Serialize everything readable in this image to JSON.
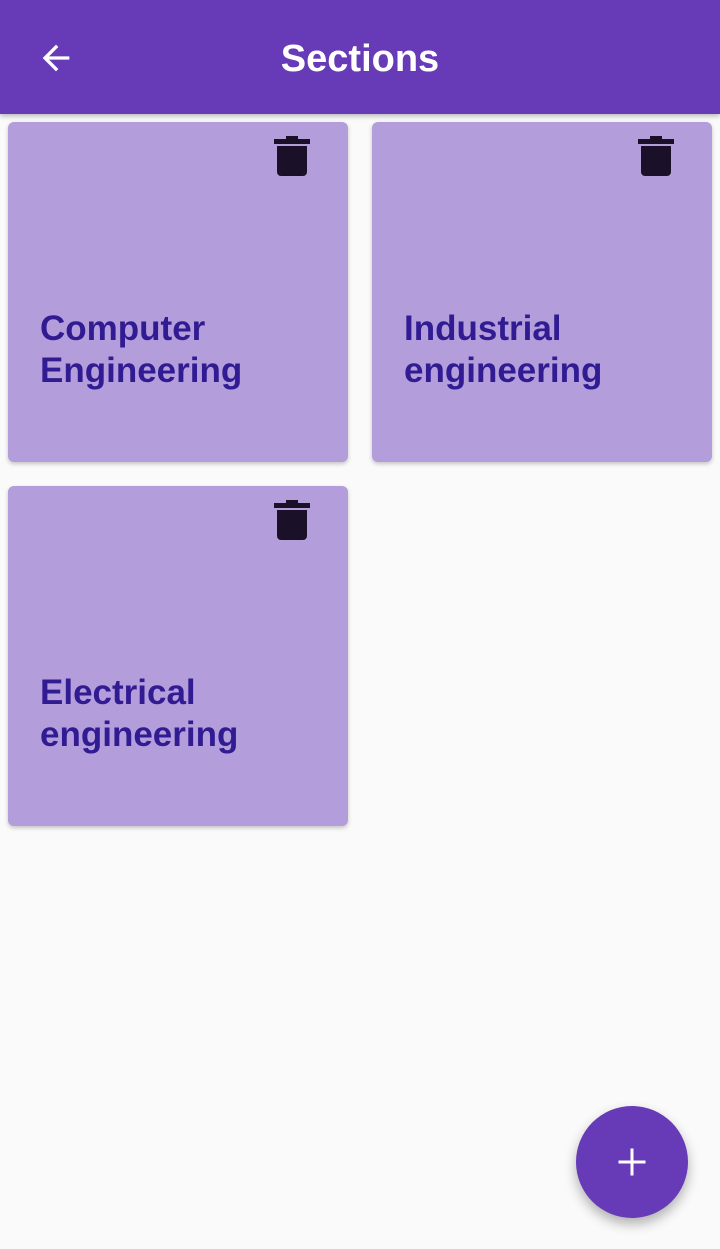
{
  "app_bar": {
    "title": "Sections",
    "back_icon": "arrow-back-icon",
    "color": "#673ab7"
  },
  "sections": [
    {
      "label": "Computer\nEngineering",
      "delete_icon": "trash-icon"
    },
    {
      "label": "Industrial\nengineering",
      "delete_icon": "trash-icon"
    },
    {
      "label": "Electrical\nengineering",
      "delete_icon": "trash-icon"
    }
  ],
  "fab": {
    "icon": "plus-icon",
    "color": "#673ab7"
  },
  "colors": {
    "card_background": "#b39ddb",
    "card_text": "#311b92",
    "page_background": "#fafafa"
  }
}
